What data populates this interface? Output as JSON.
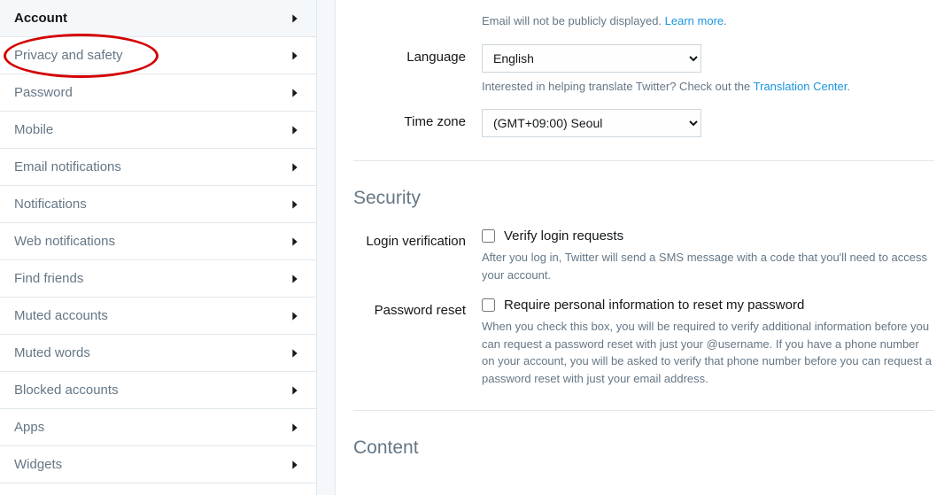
{
  "sidebar": {
    "items": [
      {
        "label": "Account",
        "active": true
      },
      {
        "label": "Privacy and safety",
        "active": false
      },
      {
        "label": "Password",
        "active": false
      },
      {
        "label": "Mobile",
        "active": false
      },
      {
        "label": "Email notifications",
        "active": false
      },
      {
        "label": "Notifications",
        "active": false
      },
      {
        "label": "Web notifications",
        "active": false
      },
      {
        "label": "Find friends",
        "active": false
      },
      {
        "label": "Muted accounts",
        "active": false
      },
      {
        "label": "Muted words",
        "active": false
      },
      {
        "label": "Blocked accounts",
        "active": false
      },
      {
        "label": "Apps",
        "active": false
      },
      {
        "label": "Widgets",
        "active": false
      }
    ]
  },
  "email": {
    "help_prefix": "Email will not be publicly displayed. ",
    "learn_more": "Learn more",
    "dot": "."
  },
  "language": {
    "label": "Language",
    "value": "English",
    "help_prefix": "Interested in helping translate Twitter? Check out the ",
    "link": "Translation Center",
    "dot": "."
  },
  "timezone": {
    "label": "Time zone",
    "value": "(GMT+09:00) Seoul"
  },
  "security": {
    "title": "Security",
    "login_verification": {
      "label": "Login verification",
      "checkbox_label": "Verify login requests",
      "help": "After you log in, Twitter will send a SMS message with a code that you'll need to access your account."
    },
    "password_reset": {
      "label": "Password reset",
      "checkbox_label": "Require personal information to reset my password",
      "help": "When you check this box, you will be required to verify additional information before you can request a password reset with just your @username. If you have a phone number on your account, you will be asked to verify that phone number before you can request a password reset with just your email address."
    }
  },
  "content": {
    "title": "Content"
  }
}
